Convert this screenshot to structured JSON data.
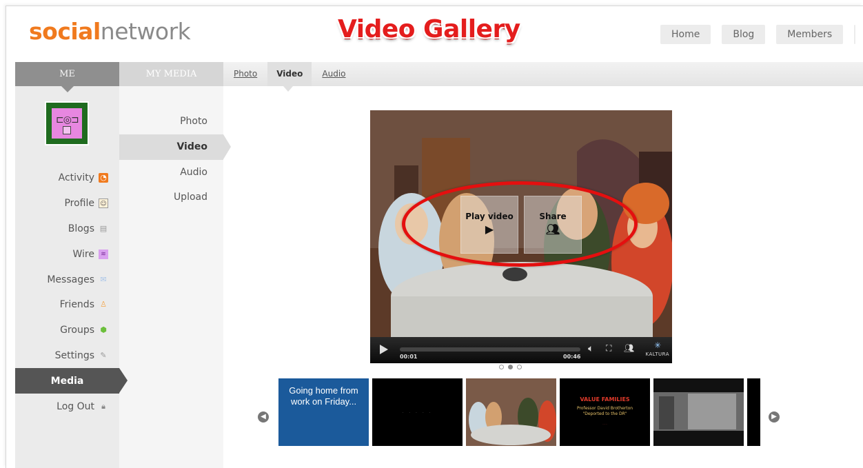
{
  "header": {
    "logo_part1": "social",
    "logo_part2": "network",
    "overlay_title": "Video Gallery",
    "nav": [
      "Home",
      "Blog",
      "Members"
    ]
  },
  "tabs": {
    "me": "ME",
    "my_media": "MY MEDIA",
    "subtabs": [
      "Photo",
      "Video",
      "Audio"
    ],
    "active_subtab": "Video"
  },
  "sidebar": {
    "items": [
      {
        "label": "Activity",
        "icon": "rss-icon",
        "color": "#f07a1e"
      },
      {
        "label": "Profile",
        "icon": "profile-icon",
        "color": "#f3a64a"
      },
      {
        "label": "Blogs",
        "icon": "blog-icon",
        "color": "#999999"
      },
      {
        "label": "Wire",
        "icon": "wire-icon",
        "color": "#c26be0"
      },
      {
        "label": "Messages",
        "icon": "envelope-icon",
        "color": "#a8c4e8"
      },
      {
        "label": "Friends",
        "icon": "friends-icon",
        "color": "#f3a64a"
      },
      {
        "label": "Groups",
        "icon": "cube-icon",
        "color": "#6cbf3c"
      },
      {
        "label": "Settings",
        "icon": "wrench-icon",
        "color": "#999999"
      },
      {
        "label": "Media",
        "icon": "",
        "active": true
      },
      {
        "label": "Log Out",
        "icon": "lock-icon",
        "color": "#888888"
      }
    ]
  },
  "media_menu": {
    "items": [
      "Photo",
      "Video",
      "Audio",
      "Upload"
    ],
    "active": "Video"
  },
  "player": {
    "play_label": "Play video",
    "share_label": "Share",
    "current_time": "00:01",
    "duration": "00:46",
    "brand": "KALTURA",
    "progress": 0.02
  },
  "carousel": {
    "pages": 3,
    "active_page": 2,
    "thumbs": [
      {
        "type": "text",
        "text": "Going home from work on Friday..."
      },
      {
        "type": "dark",
        "text": "· · · · ·"
      },
      {
        "type": "cartoon",
        "text": ""
      },
      {
        "type": "title",
        "line1": "VALUE FAMILIES",
        "line2": "Professor David Brotherton",
        "line3": "\"Deported to the DR\""
      },
      {
        "type": "photo",
        "text": ""
      },
      {
        "type": "partial",
        "text": ""
      }
    ]
  },
  "colors": {
    "accent_orange": "#f07a1e",
    "annotation_red": "#e41d1d",
    "sidebar_active": "#555555"
  }
}
